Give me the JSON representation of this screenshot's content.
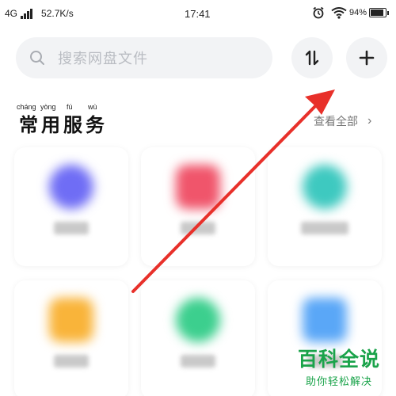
{
  "status_bar": {
    "network": "4G",
    "speed": "52.7K/s",
    "time": "17:41",
    "battery": "94%",
    "battery_level": 0.94,
    "icons": [
      "signal-icon",
      "alarm-icon",
      "wifi-icon",
      "battery-icon"
    ]
  },
  "search": {
    "placeholder": "搜索网盘文件"
  },
  "toolbar": {
    "sort_icon": "transfer-sort-icon",
    "add_icon": "plus-icon"
  },
  "section": {
    "title_chars": [
      "常",
      "用",
      "服",
      "务"
    ],
    "pinyin": [
      "cháng",
      "yòng",
      "fú",
      "wù"
    ],
    "view_all": "查看全部"
  },
  "services": [
    {
      "icon_color": "#6f6df5"
    },
    {
      "icon_color": "#f0556b"
    },
    {
      "icon_color": "#3ec9c0"
    },
    {
      "icon_color": "#f9b43a"
    },
    {
      "icon_color": "#3ccf8e"
    },
    {
      "icon_color": "#5aa7f7"
    }
  ],
  "annotation": {
    "arrow_color": "#e8302a"
  },
  "watermark": {
    "title": "百科全说",
    "subtitle": "助你轻松解决"
  }
}
